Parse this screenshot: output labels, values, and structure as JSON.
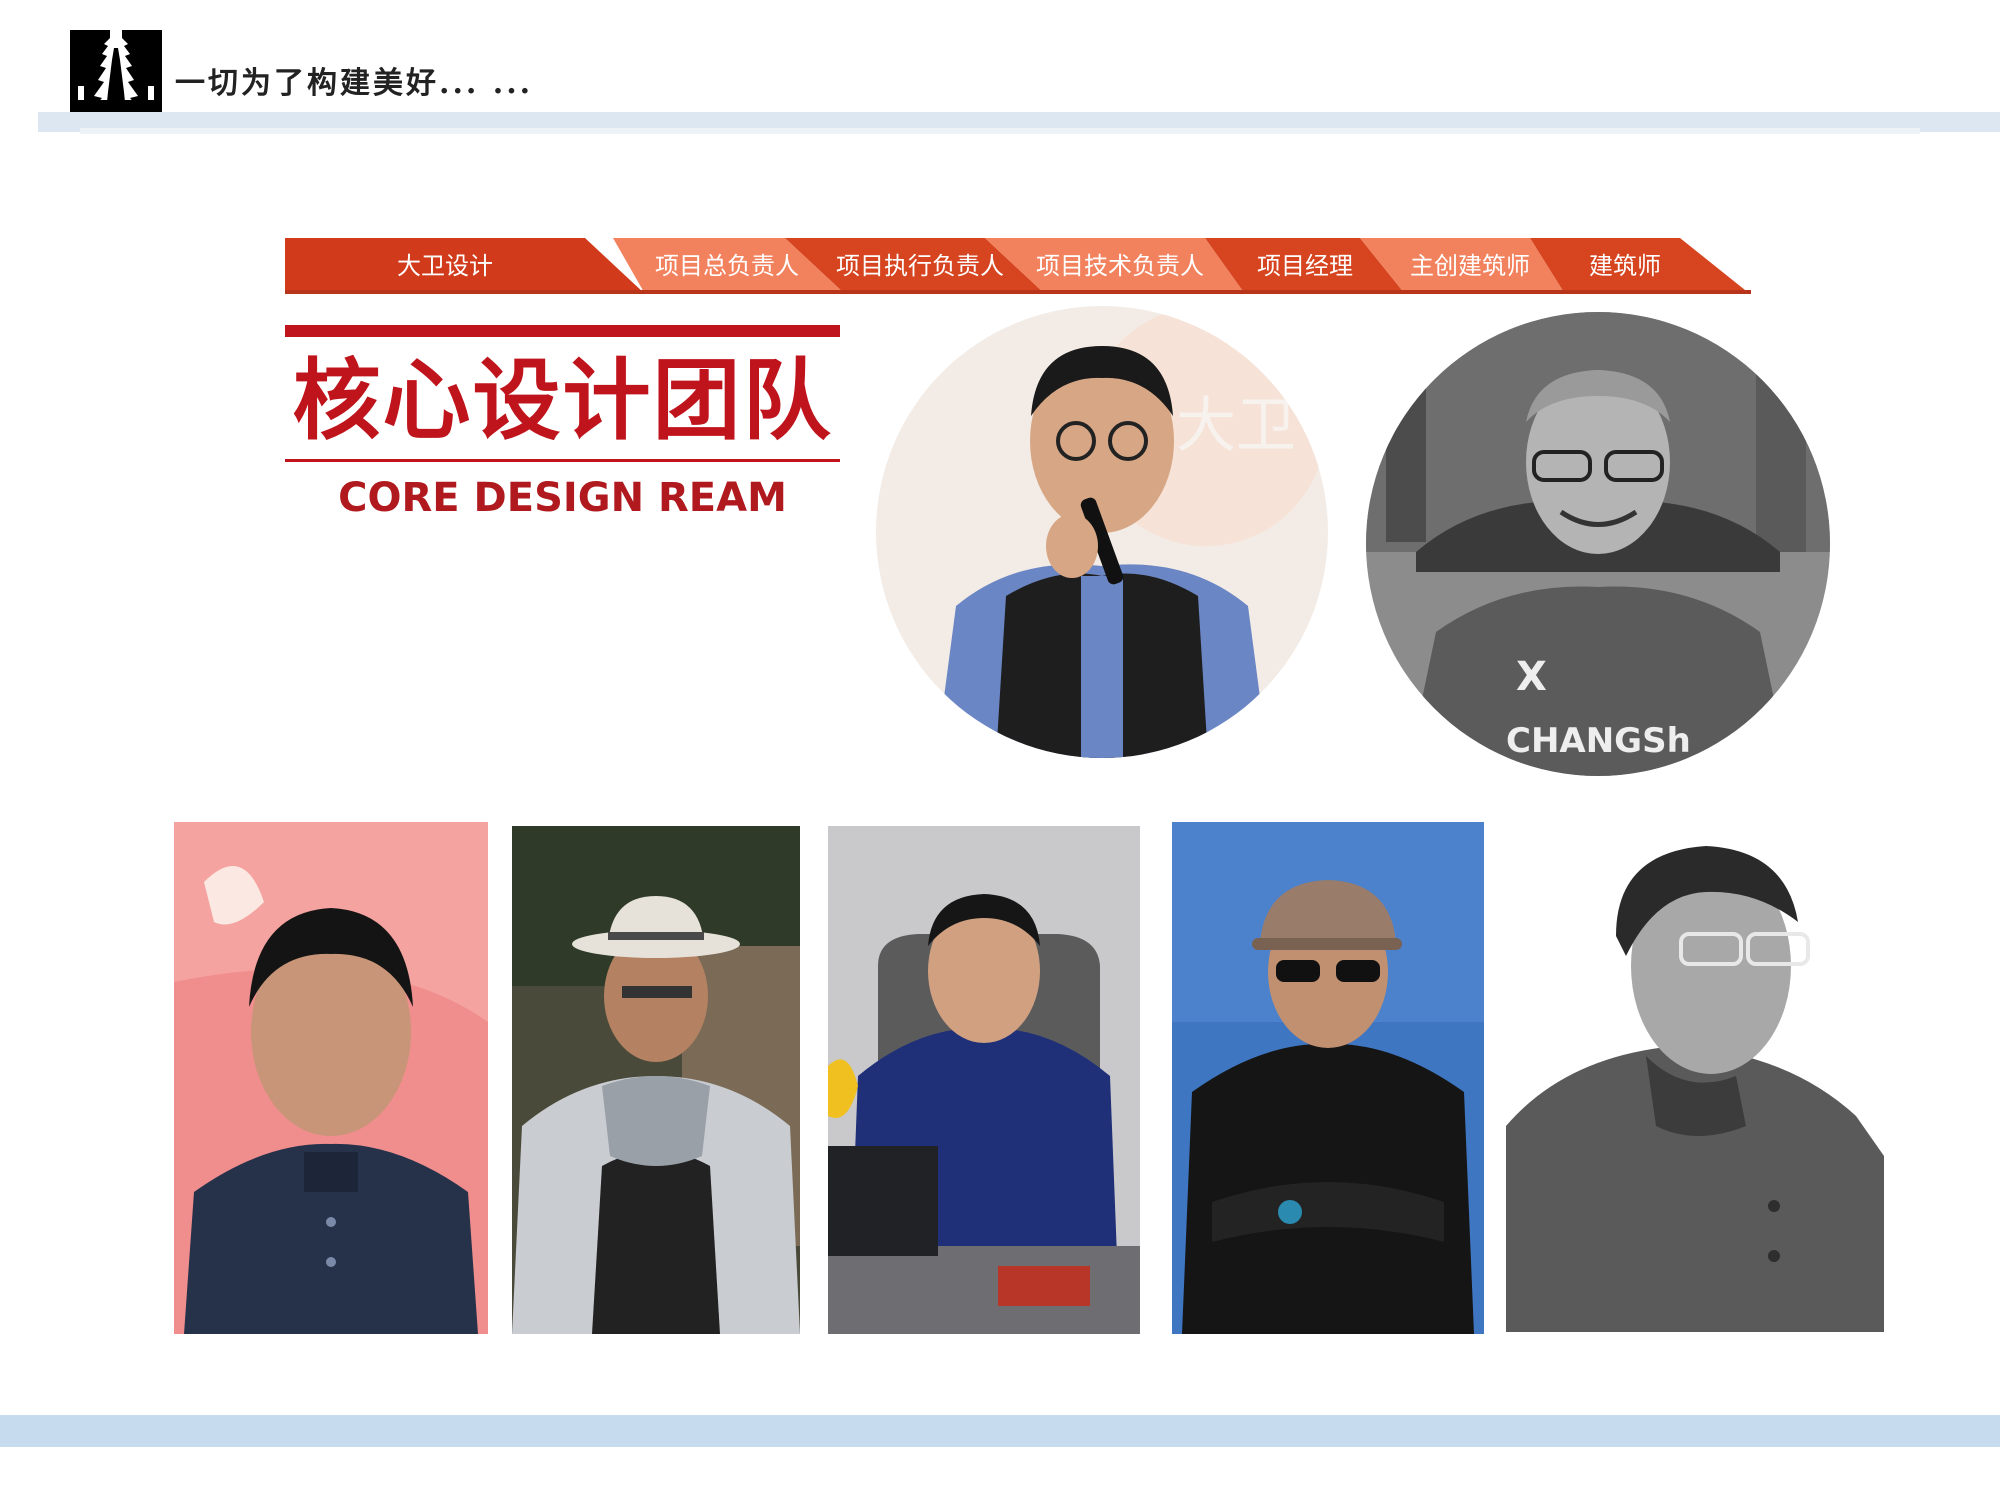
{
  "header": {
    "slogan": "一切为了构建美好... ..."
  },
  "ribbon": {
    "items": [
      {
        "label": "大卫设计",
        "color": "#d13a1a"
      },
      {
        "label": "项目总负责人",
        "color": "#f2825e"
      },
      {
        "label": "项目执行负责人",
        "color": "#d6451f"
      },
      {
        "label": "项目技术负责人",
        "color": "#f2825e"
      },
      {
        "label": "项目经理",
        "color": "#d6451f"
      },
      {
        "label": "主创建筑师",
        "color": "#f2825e"
      },
      {
        "label": "建筑师",
        "color": "#d6451f"
      }
    ]
  },
  "title": {
    "cn": "核心设计团队",
    "en": "CORE DESIGN REAM",
    "color": "#c0141c"
  },
  "circle_photos": [
    {
      "name": "portrait-speaker",
      "background": "#f3ece6"
    },
    {
      "name": "portrait-smiling-grayscale",
      "background": "#8a8a8a"
    }
  ],
  "row_photos": [
    {
      "name": "portrait-red-background",
      "background": "#f08d8d"
    },
    {
      "name": "portrait-hat-garden",
      "background": "#5a5a4a"
    },
    {
      "name": "portrait-office-desk",
      "background": "#c8c8cc"
    },
    {
      "name": "portrait-sky-sunglasses",
      "background": "#3f76c2"
    },
    {
      "name": "portrait-grayscale-profile",
      "background": "#ffffff"
    }
  ]
}
